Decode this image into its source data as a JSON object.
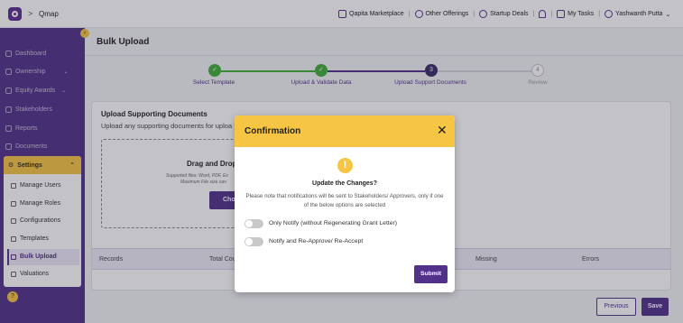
{
  "header": {
    "app_name": "Qmap",
    "links": [
      "Qapita Marketplace",
      "Other Offerings",
      "Startup Deals"
    ],
    "my_tasks": "My Tasks",
    "user_name": "Yashwanth Putta"
  },
  "sidebar": {
    "items": [
      {
        "label": "Dashboard",
        "icon": "pulse-icon"
      },
      {
        "label": "Ownership",
        "icon": "grid-icon"
      },
      {
        "label": "Equity Awards",
        "icon": "users-icon"
      },
      {
        "label": "Stakeholders",
        "icon": "user-icon"
      },
      {
        "label": "Reports",
        "icon": "bar-chart-icon"
      },
      {
        "label": "Documents",
        "icon": "folder-icon"
      }
    ],
    "settings": {
      "label": "Settings",
      "sub_items": [
        "Manage Users",
        "Manage Roles",
        "Configurations",
        "Templates",
        "Bulk Upload",
        "Valuations"
      ],
      "active": "Bulk Upload"
    }
  },
  "page": {
    "title": "Bulk Upload",
    "steps": [
      {
        "label": "Select Template",
        "state": "done",
        "marker": ""
      },
      {
        "label": "Upload & Validate Data",
        "state": "done",
        "marker": ""
      },
      {
        "label": "Upload Support Documents",
        "state": "current",
        "marker": "3"
      },
      {
        "label": "Review",
        "state": "pending",
        "marker": "4"
      }
    ],
    "upload": {
      "title": "Upload Supporting Documents",
      "subtitle": "Upload any supporting documents for uploa",
      "drop_title": "Drag and Drop",
      "supported": "Supported files: Word, PDF, Ex",
      "max_size": "Maximum File size can",
      "choose_label": "Cho"
    },
    "table_headers": [
      "Records",
      "Total Cou",
      "Missing",
      "Errors"
    ],
    "buttons": {
      "previous": "Previous",
      "save": "Save"
    }
  },
  "modal": {
    "title": "Confirmation",
    "heading": "Update the Changes?",
    "note": "Please note that notifications will be sent to Stakeholders/ Approvers, only if one of the below options are selected",
    "options": [
      {
        "label": "Only Notify (without Regenerating Grant Letter)",
        "checked": false
      },
      {
        "label": "Notify and Re-Approve/ Re-Accept",
        "checked": false
      }
    ],
    "submit": "Submit"
  },
  "colors": {
    "brand": "#52318a",
    "accent": "#f6c544",
    "success": "#3fae3a",
    "pending": "#c9c9c9"
  }
}
